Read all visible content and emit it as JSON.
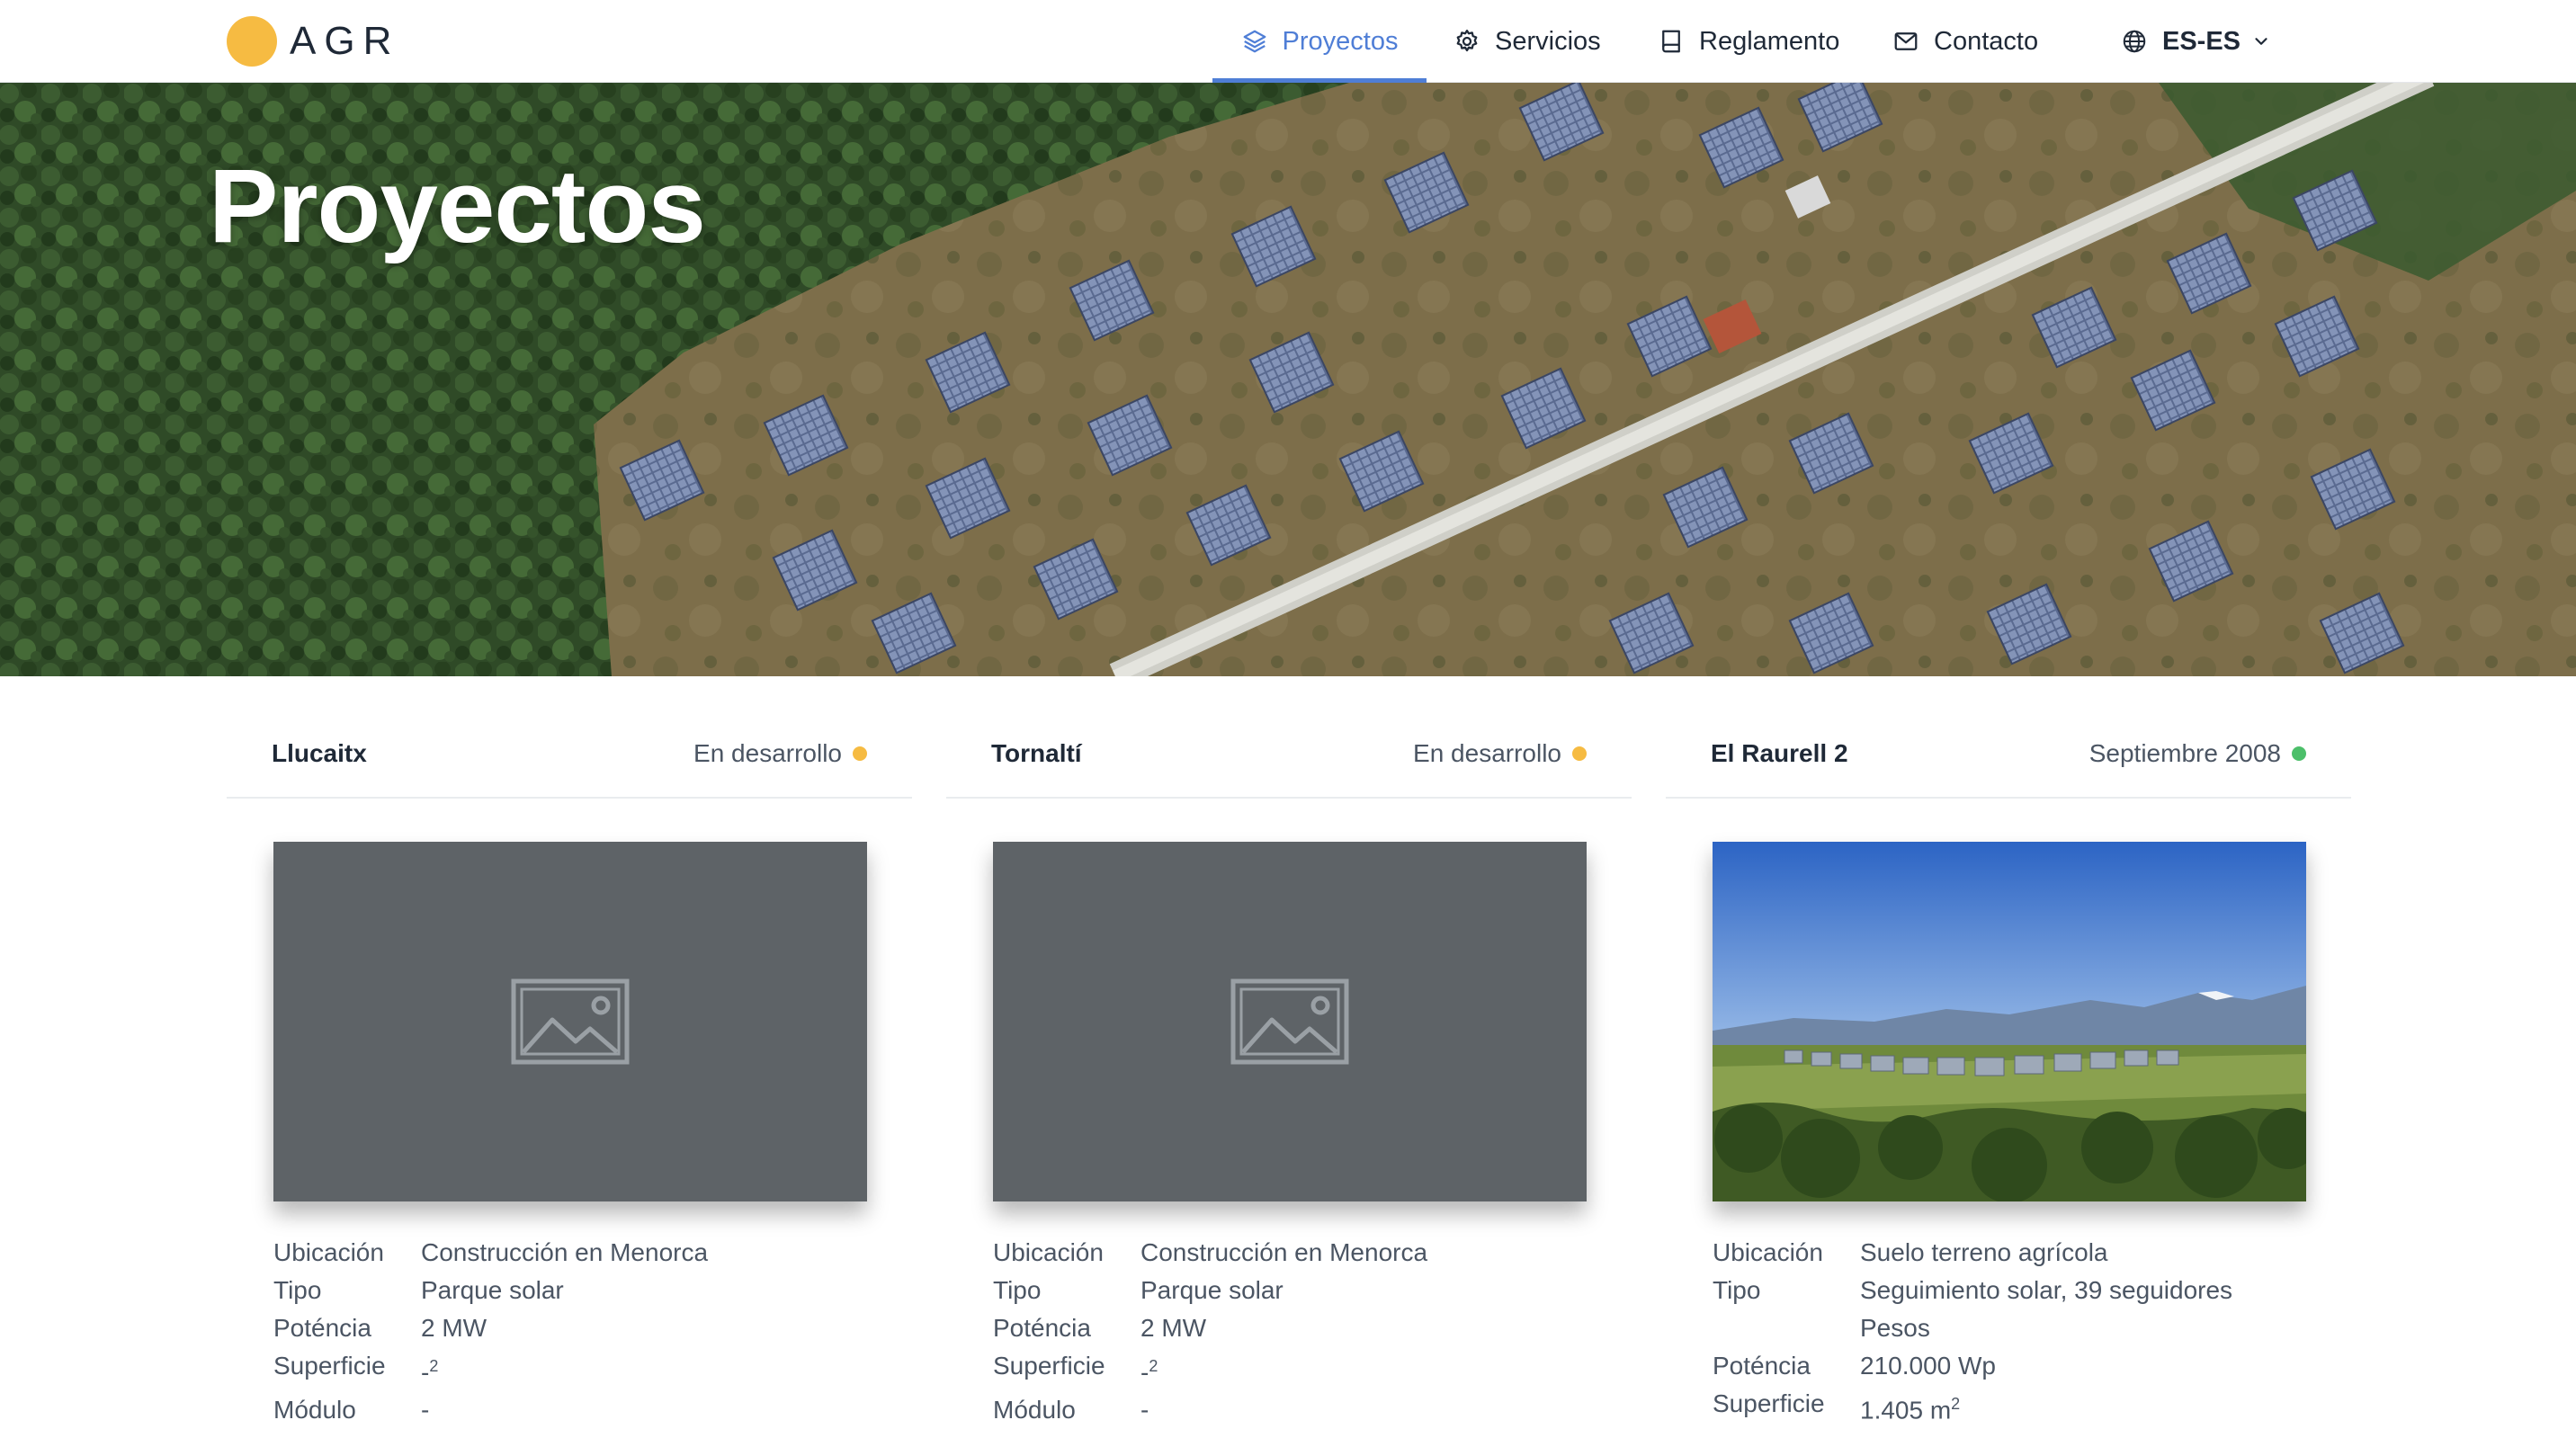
{
  "brand": {
    "name": "AGR",
    "color": "#f6bb42"
  },
  "nav": {
    "items": [
      {
        "label": "Proyectos",
        "icon": "layers-icon",
        "active": true
      },
      {
        "label": "Servicios",
        "icon": "gear-icon"
      },
      {
        "label": "Reglamento",
        "icon": "book-icon"
      },
      {
        "label": "Contacto",
        "icon": "mail-icon"
      }
    ],
    "language": {
      "label": "ES-ES",
      "icon": "globe-icon"
    },
    "accent": "#4f7ed6"
  },
  "hero": {
    "title": "Proyectos"
  },
  "labels": {
    "ubicacion": "Ubicación",
    "tipo": "Tipo",
    "potencia": "Poténcia",
    "superficie": "Superficie",
    "modulo": "Módulo"
  },
  "status_colors": {
    "development": "#f6bb42",
    "completed": "#4cbf6a"
  },
  "projects": [
    {
      "name": "Llucaitx",
      "status": "En desarrollo",
      "image": "placeholder",
      "ubicacion": "Construcción en Menorca",
      "tipo": "Parque solar",
      "potencia": "2 MW",
      "superficie": "-",
      "superficie_unit": "2",
      "modulo": "-"
    },
    {
      "name": "Tornaltí",
      "status": "En desarrollo",
      "image": "placeholder",
      "ubicacion": "Construcción en Menorca",
      "tipo": "Parque solar",
      "potencia": "2 MW",
      "superficie": "-",
      "superficie_unit": "2",
      "modulo": "-"
    },
    {
      "name": "El Raurell 2",
      "status": "Septiembre 2008",
      "image": "photo",
      "ubicacion": "Suelo terreno agrícola",
      "tipo": "Seguimiento solar, 39 seguidores",
      "tipo_extra": "Pesos",
      "potencia": "210.000 Wp",
      "superficie": "1.405 m",
      "superficie_unit": "2"
    }
  ]
}
